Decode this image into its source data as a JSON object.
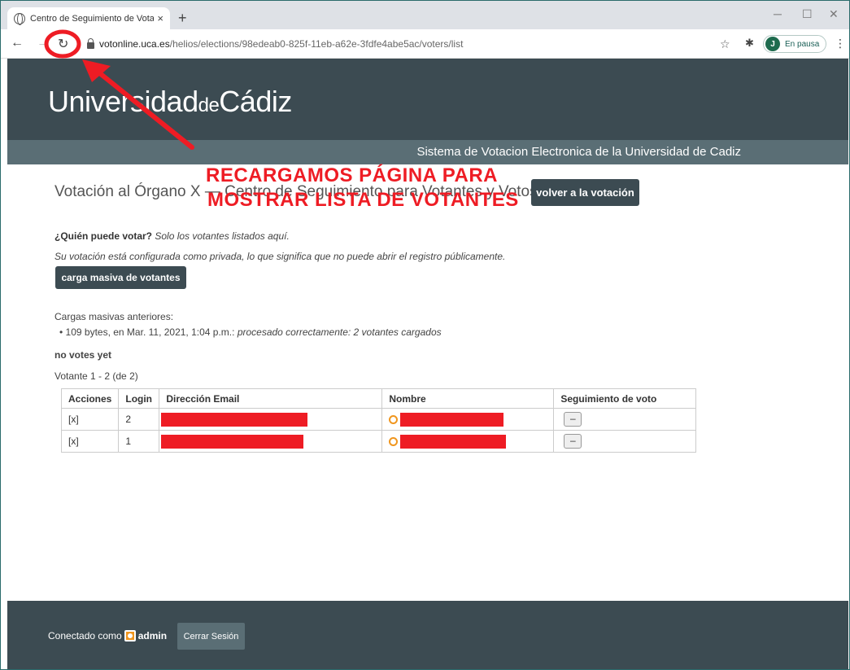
{
  "browser": {
    "tab_title": "Centro de Seguimiento de Votan",
    "tab_close": "×",
    "new_tab": "+",
    "url_host": "votonline.uca.es",
    "url_path": "/helios/elections/98edeab0-825f-11eb-a62e-3fdfe4abe5ac/voters/list",
    "profile_initial": "J",
    "profile_status": "En pausa"
  },
  "header": {
    "brand_part1": "Universidad",
    "brand_part2": "de",
    "brand_part3": "Cádiz",
    "subtitle": "Sistema de Votacion Electronica de la Universidad de Cadiz"
  },
  "main": {
    "title": "Votación al Órgano X — Centro de Seguimiento para Votantes y Votos",
    "back_button": "volver a la votación",
    "who_label": "¿Quién puede votar?",
    "who_value": "Solo los votantes listados aquí.",
    "private_note": "Su votación está configurada como privada, lo que significa que no puede abrir el registro públicamente.",
    "bulk_button": "carga masiva de votantes",
    "previous_uploads_label": "Cargas masivas anteriores:",
    "upload_entry_prefix": "109 bytes, en Mar. 11, 2021, 1:04 p.m.:",
    "upload_entry_status": "procesado correctamente: 2 votantes cargados",
    "no_votes": "no votes yet",
    "pagination": "Votante 1 - 2 (de 2)"
  },
  "table": {
    "headers": [
      "Acciones",
      "Login",
      "Dirección Email",
      "Nombre",
      "Seguimiento de voto"
    ],
    "rows": [
      {
        "action": "[x]",
        "login": "2",
        "track": "–"
      },
      {
        "action": "[x]",
        "login": "1",
        "track": "–"
      }
    ]
  },
  "footer": {
    "connected_as": "Conectado como",
    "user": "admin",
    "logout": "Cerrar Sesión"
  },
  "annotation": {
    "line1": "RECARGAMOS  PÁGINA  PARA",
    "line2": "MOSTRAR LISTA DE VOTANTES",
    "color": "#ee1c24"
  },
  "colors": {
    "header_bg": "#3c4b52",
    "subbar_bg": "#5a6e75",
    "accent_orange": "#f0961e"
  }
}
